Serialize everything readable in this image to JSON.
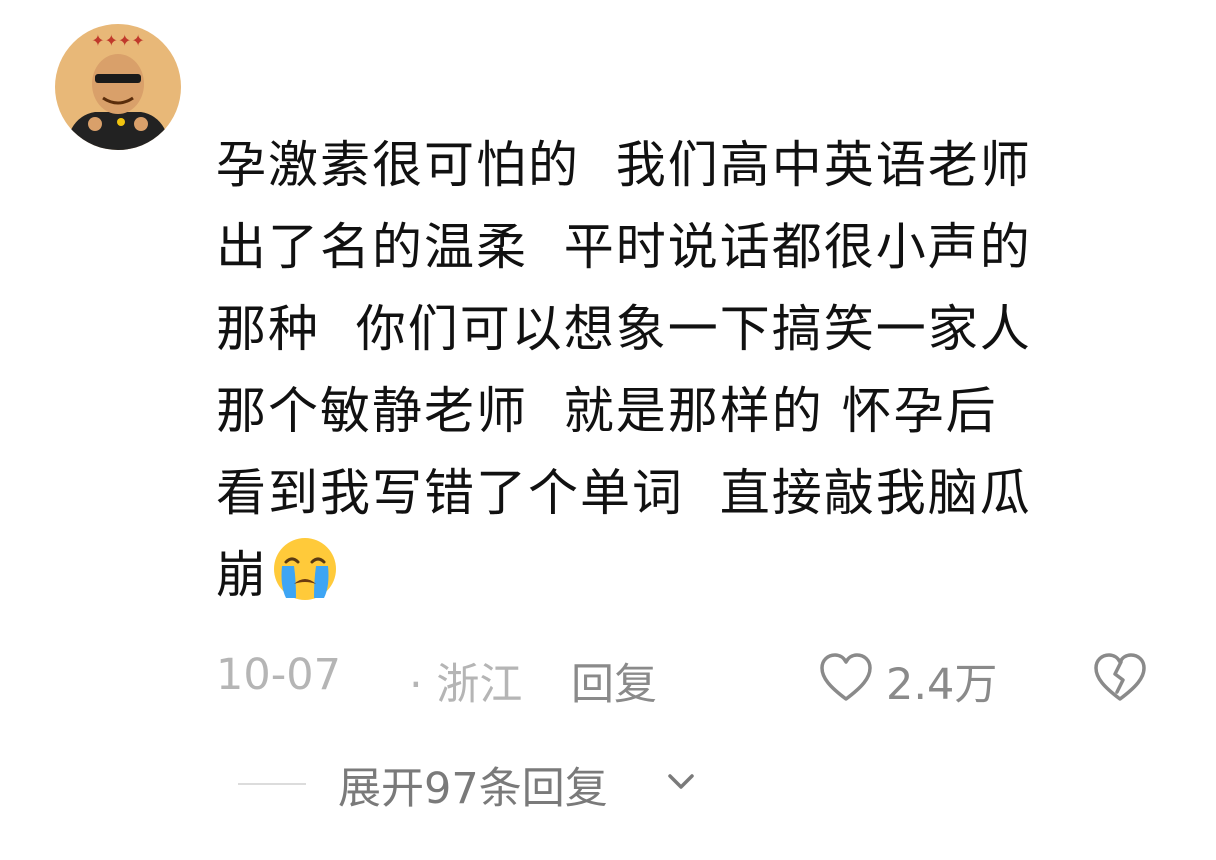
{
  "comment": {
    "avatar": {
      "icon": "user-avatar-cartoon",
      "colors": {
        "background": "#e8b878",
        "banner_text": "#c0392b",
        "jacket": "#222222"
      }
    },
    "text": "孕激素很可怕的  我们高中英语老师\n出了名的温柔  平时说话都很小声的\n那种  你们可以想象一下搞笑一家人\n那个敏静老师  就是那样的 怀孕后\n看到我写错了个单词  直接敲我脑瓜\n崩",
    "emoji": "loudly-crying-face",
    "meta": {
      "date": "10-07",
      "location": "· 浙江",
      "reply_label": "回复"
    },
    "actions": {
      "like_icon": "heart-outline-icon",
      "like_count": "2.4万",
      "dislike_icon": "broken-heart-icon"
    },
    "expand": {
      "label": "展开97条回复",
      "icon": "chevron-down-icon"
    }
  },
  "colors": {
    "text_primary": "#111111",
    "text_meta": "#b5b5b5",
    "text_secondary": "#8a8a8a",
    "divider": "#dcdcdc"
  }
}
